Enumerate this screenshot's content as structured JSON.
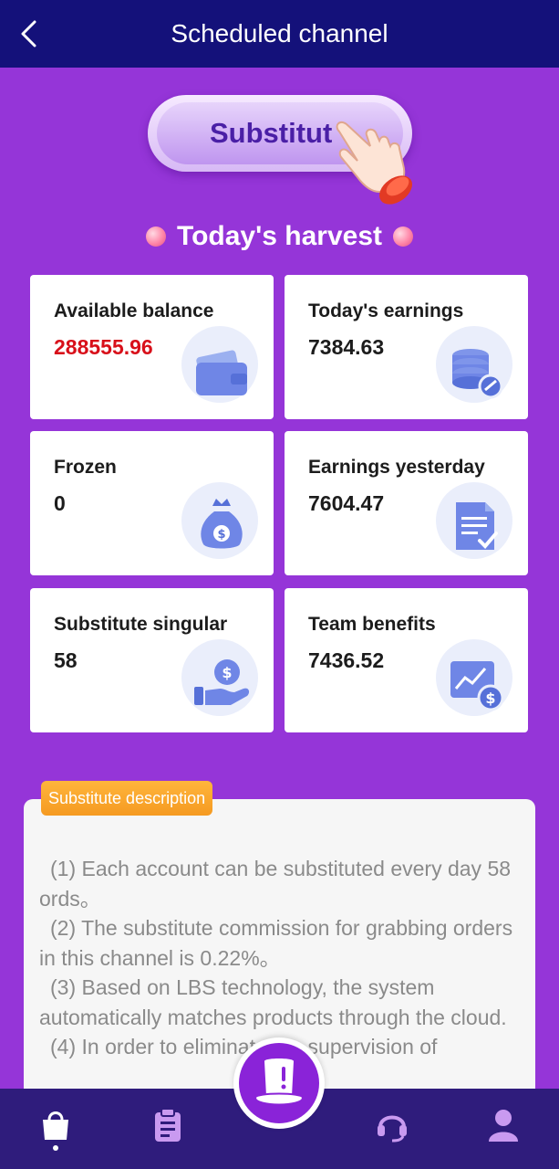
{
  "header": {
    "title": "Scheduled channel",
    "back_icon": "chevron-left-icon"
  },
  "substitute_button": {
    "label": "Substitut",
    "hand_icon": "pointing-hand-icon"
  },
  "harvest": {
    "title": "Today's harvest"
  },
  "cards": [
    {
      "label": "Available balance",
      "value": "288555.96",
      "icon": "wallet-icon",
      "value_color": "#d8101a"
    },
    {
      "label": "Today's earnings",
      "value": "7384.63",
      "icon": "coins-stack-icon"
    },
    {
      "label": "Frozen",
      "value": "0",
      "icon": "money-bag-icon"
    },
    {
      "label": "Earnings yesterday",
      "value": "7604.47",
      "icon": "document-check-icon"
    },
    {
      "label": "Substitute singular",
      "value": "58",
      "icon": "hand-coin-icon"
    },
    {
      "label": "Team benefits",
      "value": "7436.52",
      "icon": "chart-dollar-icon"
    }
  ],
  "description": {
    "tag": "Substitute description",
    "paragraphs": [
      "(1) Each account can be substituted every day 58 ords。",
      "(2) The substitute commission for grabbing orders in this channel is 0.22%。",
      "(3) Based on LBS technology, the system automatically matches products through the cloud.",
      "(4) In order to eliminate the supervision of"
    ]
  },
  "nav": {
    "items": [
      "shopping-bag-icon",
      "clipboard-icon",
      "top-hat-icon",
      "headset-icon",
      "user-icon"
    ]
  },
  "colors": {
    "background": "#9535d8",
    "header": "#14117a",
    "nav": "#2f1c7c",
    "accent_orange": "#f59a21"
  }
}
